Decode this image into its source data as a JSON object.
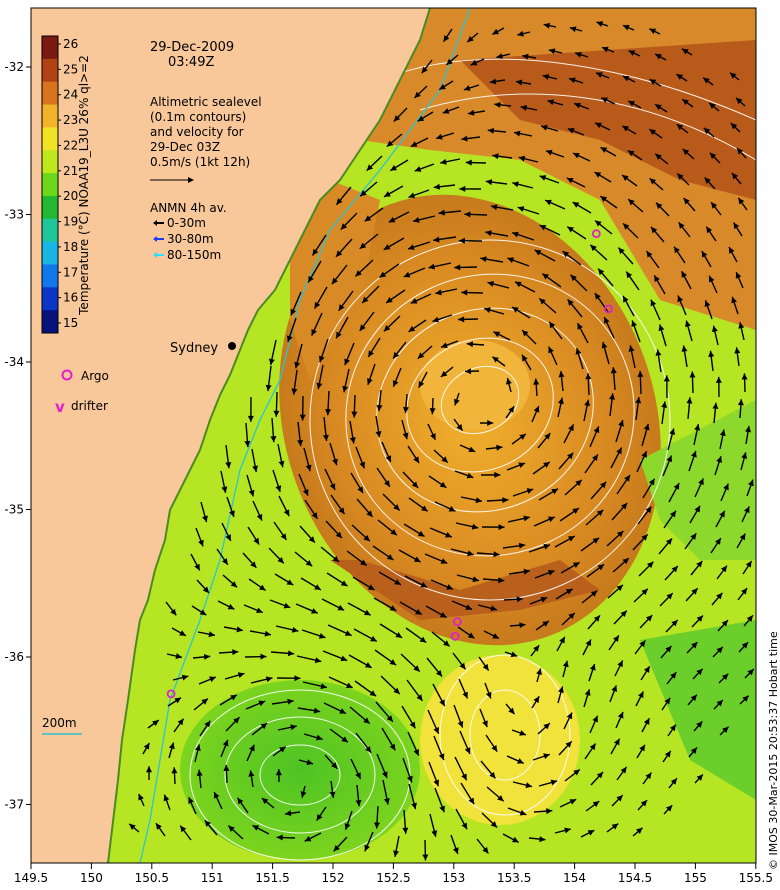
{
  "title": {
    "date": "29-Dec-2009",
    "time": "03:49Z"
  },
  "altimetry_note": [
    "Altimetric sealevel",
    "(0.1m contours)",
    "and velocity for",
    "29-Dec 03Z",
    "0.5m/s (1kt 12h)"
  ],
  "anmn": {
    "title": "ANMN 4h av.",
    "entries": [
      {
        "label": "0-30m",
        "color": "#000000"
      },
      {
        "label": "30-80m",
        "color": "#1a3cff"
      },
      {
        "label": "80-150m",
        "color": "#2fe0ff"
      }
    ]
  },
  "colorbar": {
    "label": "Temperature (°C) NOAA19_L3U 26% ql>=2",
    "min": 15,
    "max": 26,
    "ticks": [
      "15",
      "16",
      "17",
      "18",
      "19",
      "20",
      "21",
      "22",
      "23",
      "24",
      "25",
      "26"
    ],
    "colors": [
      "#07127a",
      "#0a36c8",
      "#1078ea",
      "#18b6e6",
      "#1ec79a",
      "#22b832",
      "#6cd81c",
      "#bde81a",
      "#f2e424",
      "#f2b22a",
      "#d8741e",
      "#b04214",
      "#7a1a10"
    ]
  },
  "place_label": "Sydney",
  "symbol_legend": [
    {
      "symbol": "o",
      "label": "Argo",
      "color": "#e020c8"
    },
    {
      "symbol": "v",
      "label": "drifter",
      "color": "#e020c8"
    }
  ],
  "isobath_label": "200m",
  "credit": "© IMOS 30-Mar-2015 20:53:37 Hobart time",
  "axes": {
    "x_ticks": [
      "149.5",
      "150",
      "150.5",
      "151",
      "151.5",
      "152",
      "152.5",
      "153",
      "153.5",
      "154",
      "154.5",
      "155",
      "155.5"
    ],
    "y_ticks": [
      "-32",
      "-33",
      "-34",
      "-35",
      "-36",
      "-37"
    ],
    "lon_range": [
      149.5,
      155.5
    ],
    "lat_range": [
      -37.5,
      -31.6
    ]
  },
  "argo_floats": [
    {
      "lon": 154.18,
      "lat": -33.13
    },
    {
      "lon": 154.28,
      "lat": -33.64
    },
    {
      "lon": 153.03,
      "lat": -35.76
    },
    {
      "lon": 153.01,
      "lat": -35.86
    },
    {
      "lon": 150.66,
      "lat": -36.25
    }
  ],
  "colors": {
    "land": "#f8c89a",
    "coast": "#4a8a22",
    "isobath": "#2bc4d0",
    "contour": "#ffffff",
    "vector": "#000000"
  }
}
